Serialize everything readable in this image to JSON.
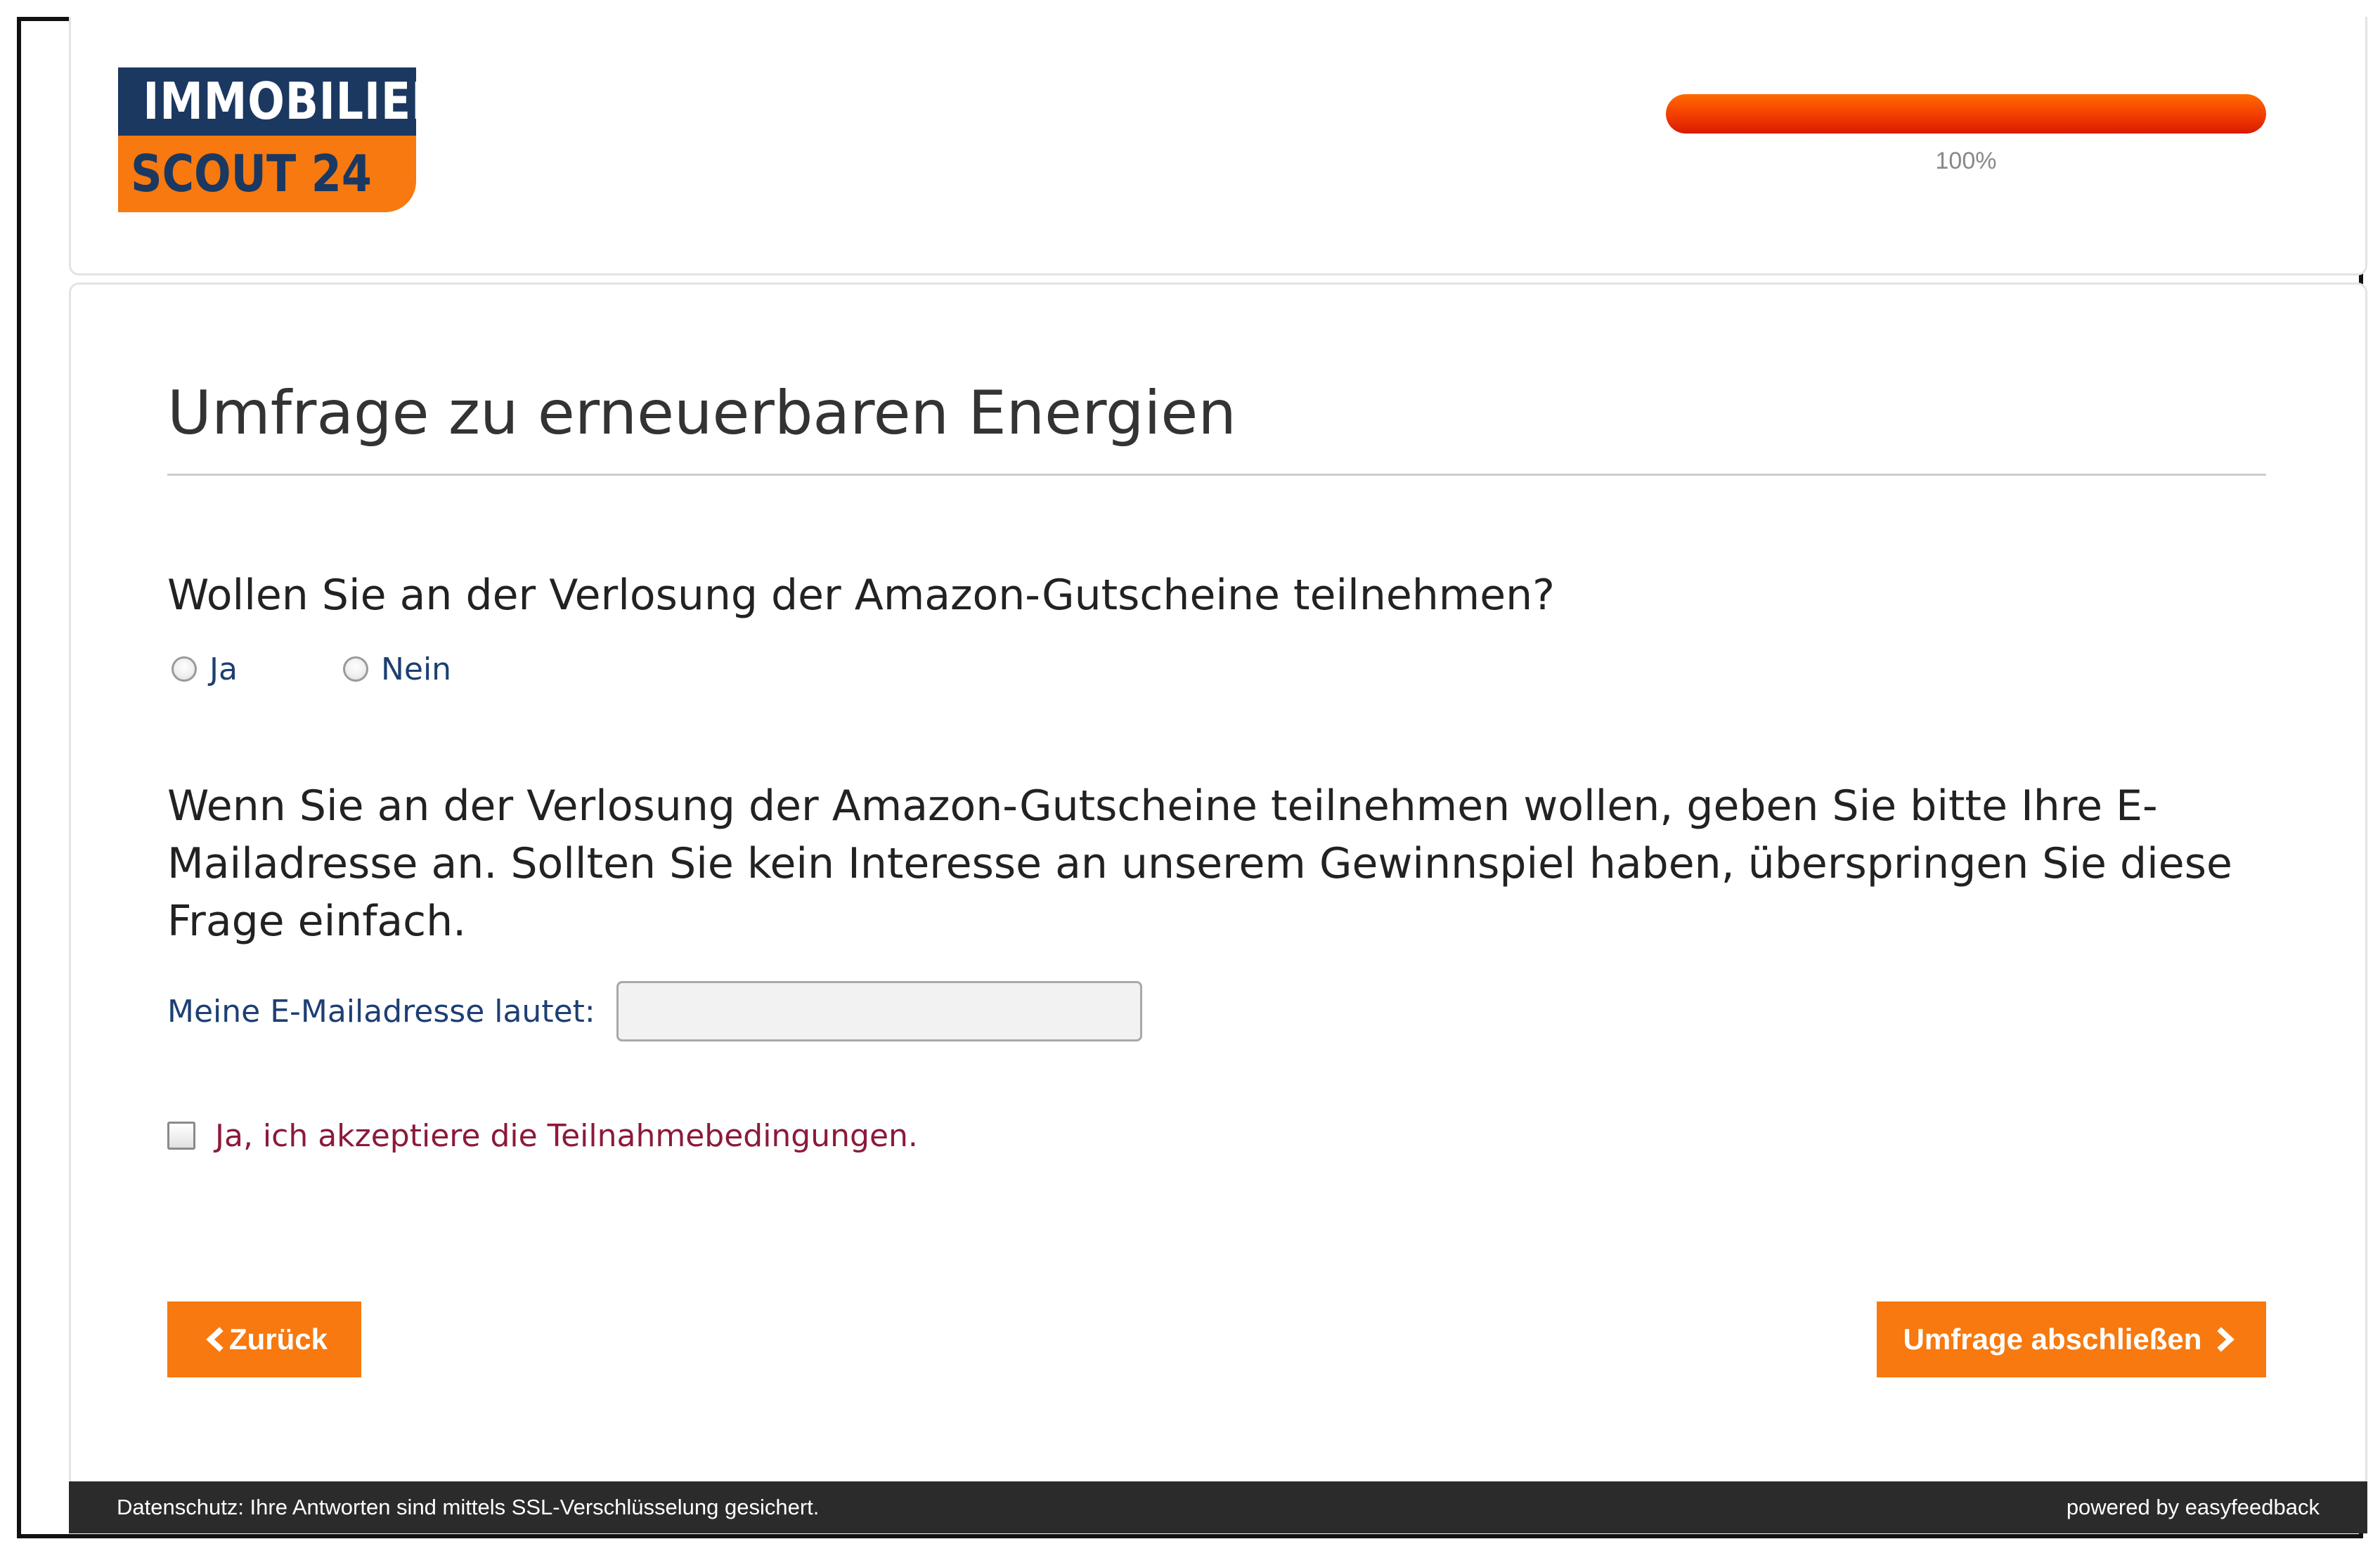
{
  "logo": {
    "line1": "IMMOBILIEN",
    "line2": "SCOUT 24",
    "top_color": "#1b3861",
    "bottom_color": "#f7790f"
  },
  "progress": {
    "value_percent": 100,
    "label": "100%",
    "color": "#f23c00"
  },
  "survey": {
    "title": "Umfrage zu erneuerbaren Energien",
    "question1": {
      "text": "Wollen Sie an der Verlosung der Amazon-Gutscheine teilnehmen?",
      "options": [
        "Ja",
        "Nein"
      ],
      "selected": null
    },
    "question2": {
      "text": "Wenn Sie an der Verlosung der Amazon-Gutscheine teilnehmen wollen, geben Sie bitte Ihre E-Mailadresse an. Sollten Sie kein Interesse an unserem Gewinnspiel haben, überspringen Sie diese Frage einfach.",
      "email_label": "Meine E-Mailadresse lautet:",
      "email_value": ""
    },
    "consent": {
      "label": "Ja, ich akzeptiere die Teilnahmebedingungen.",
      "checked": false
    }
  },
  "buttons": {
    "back_label": "Zurück",
    "finish_label": "Umfrage abschließen",
    "color": "#f7790f"
  },
  "footer": {
    "privacy": "Datenschutz: Ihre Antworten sind mittels SSL-Verschlüsselung gesichert.",
    "powered_by": "powered by easyfeedback"
  }
}
